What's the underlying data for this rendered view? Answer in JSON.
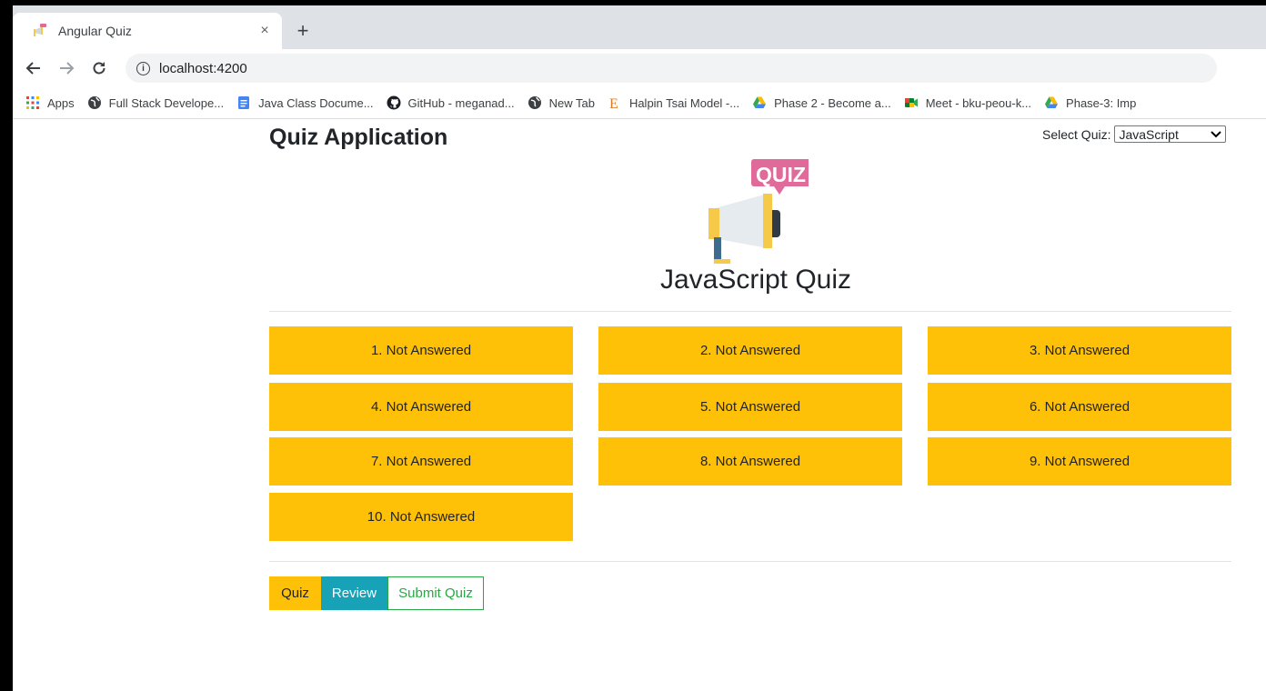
{
  "browser": {
    "tab_title": "Angular Quiz",
    "new_tab_symbol": "+",
    "close_symbol": "×",
    "url": "localhost:4200",
    "bookmarks": [
      {
        "label": "Apps",
        "icon": "apps-grid-icon"
      },
      {
        "label": "Full Stack Develope...",
        "icon": "globe-icon"
      },
      {
        "label": "Java Class Docume...",
        "icon": "docs-icon"
      },
      {
        "label": "GitHub - meganad...",
        "icon": "github-icon"
      },
      {
        "label": "New Tab",
        "icon": "globe-icon"
      },
      {
        "label": "Halpin Tsai Model -...",
        "icon": "e-letter-icon"
      },
      {
        "label": "Phase 2 - Become a...",
        "icon": "drive-icon"
      },
      {
        "label": "Meet - bku-peou-k...",
        "icon": "meet-icon"
      },
      {
        "label": "Phase-3: Imp",
        "icon": "drive-icon"
      }
    ]
  },
  "header": {
    "title": "Quiz Application",
    "select_label": "Select Quiz:",
    "select_value": "JavaScript"
  },
  "quiz": {
    "logo_text": "QUIZ",
    "heading": "JavaScript Quiz",
    "questions": [
      "1. Not Answered",
      "2. Not Answered",
      "3. Not Answered",
      "4. Not Answered",
      "5. Not Answered",
      "6. Not Answered",
      "7. Not Answered",
      "8. Not Answered",
      "9. Not Answered",
      "10. Not Answered"
    ]
  },
  "actions": {
    "quiz": "Quiz",
    "review": "Review",
    "submit": "Submit Quiz"
  },
  "colors": {
    "warning": "#ffc107",
    "info": "#17a2b8",
    "success": "#28a745"
  }
}
